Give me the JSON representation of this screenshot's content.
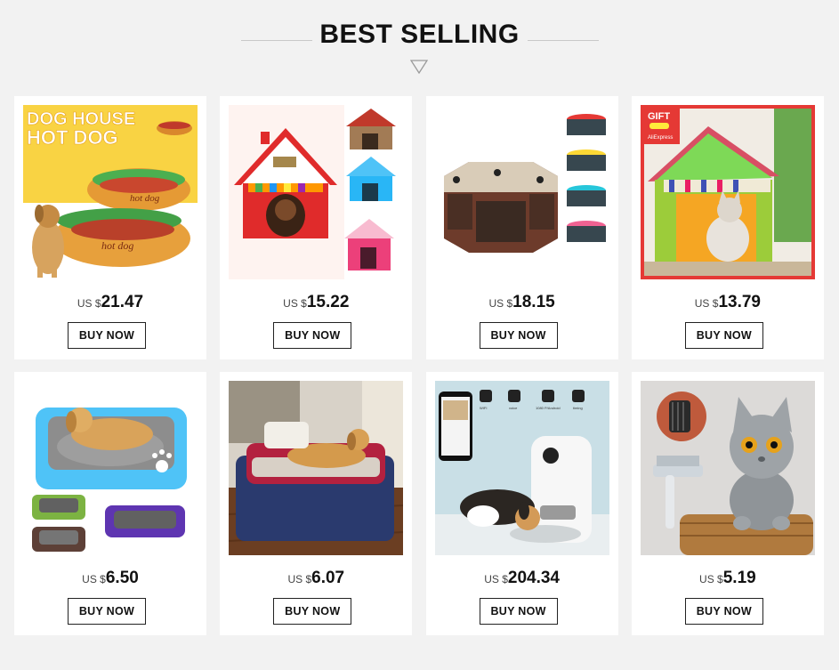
{
  "header": {
    "title": "BEST SELLING"
  },
  "colors": {
    "page_bg": "#f2f2f2",
    "card_bg": "#ffffff",
    "text": "#111111",
    "divider": "#c9c9c9"
  },
  "products": [
    {
      "image_name": "hot-dog-dog-bed-image",
      "image_text_1": "DOG HOUSE",
      "image_text_2": "HOT DOG",
      "image_text_3": "hot dog",
      "image_text_4": "hot dog",
      "currency": "US $",
      "price": "21.47",
      "button": "BUY NOW"
    },
    {
      "image_name": "red-cottage-pet-house-image",
      "currency": "US $",
      "price": "15.22",
      "button": "BUY NOW"
    },
    {
      "image_name": "octagon-pet-playpen-image",
      "currency": "US $",
      "price": "18.15",
      "button": "BUY NOW"
    },
    {
      "image_name": "green-house-cat-bed-image",
      "image_text_1": "GIFT",
      "image_text_2": "AliExpress",
      "currency": "US $",
      "price": "13.79",
      "button": "BUY NOW"
    },
    {
      "image_name": "blue-paw-dog-bed-image",
      "currency": "US $",
      "price": "6.50",
      "button": "BUY NOW"
    },
    {
      "image_name": "navy-red-dog-bed-image",
      "currency": "US $",
      "price": "6.07",
      "button": "BUY NOW"
    },
    {
      "image_name": "smart-pet-feeder-image",
      "image_text_1": "WIFI",
      "image_text_2": "voice",
      "image_text_3": "1080 P/Android",
      "image_text_4": "timing",
      "currency": "US $",
      "price": "204.34",
      "button": "BUY NOW"
    },
    {
      "image_name": "cat-grooming-comb-image",
      "currency": "US $",
      "price": "5.19",
      "button": "BUY NOW"
    }
  ]
}
